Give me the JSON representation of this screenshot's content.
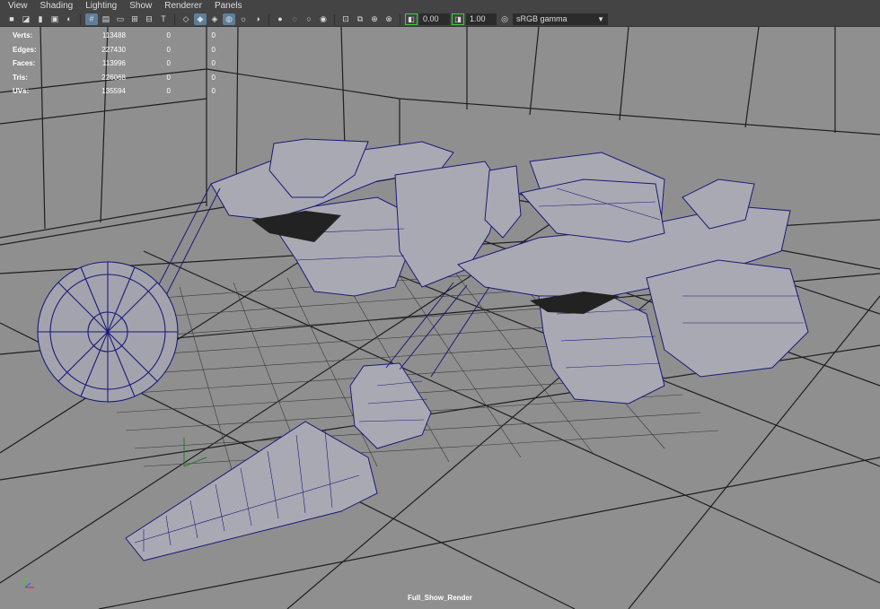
{
  "menu": [
    "View",
    "Shading",
    "Lighting",
    "Show",
    "Renderer",
    "Panels"
  ],
  "toolbar": {
    "exposure_value": "0.00",
    "gamma_value": "1.00",
    "color_space": "sRGB gamma",
    "icons": [
      "camera-icon",
      "select-camera-icon",
      "bookmark-icon",
      "image-plane-icon",
      "grid-icon",
      "film-gate-icon",
      "resolution-gate-icon",
      "field-chart-icon",
      "safe-action-icon",
      "wireframe-icon",
      "smooth-shade-icon",
      "textured-icon",
      "lights-icon",
      "shadows-icon",
      "ambient-occlusion-icon",
      "motion-blur-icon",
      "anti-aliasing-icon",
      "isolate-select-icon",
      "xray-icon",
      "xray-joints-icon",
      "xray-components-icon",
      "exposure-icon",
      "gamma-icon",
      "color-management-icon"
    ]
  },
  "hud": {
    "rows": [
      {
        "label": "Verts:",
        "value": "113488",
        "sel": "0",
        "tri": "0"
      },
      {
        "label": "Edges:",
        "value": "227430",
        "sel": "0",
        "tri": "0"
      },
      {
        "label": "Faces:",
        "value": "113996",
        "sel": "0",
        "tri": "0"
      },
      {
        "label": "Tris:",
        "value": "226068",
        "sel": "0",
        "tri": "0"
      },
      {
        "label": "UVs:",
        "value": "135594",
        "sel": "0",
        "tri": "0"
      }
    ]
  },
  "camera_name": "Full_Show_Render",
  "colors": {
    "viewport_bg": "#8f8f8f",
    "wire": "#1a1a7a",
    "mesh_fill": "#a9a9b3",
    "grid": "#1e1e1e"
  }
}
